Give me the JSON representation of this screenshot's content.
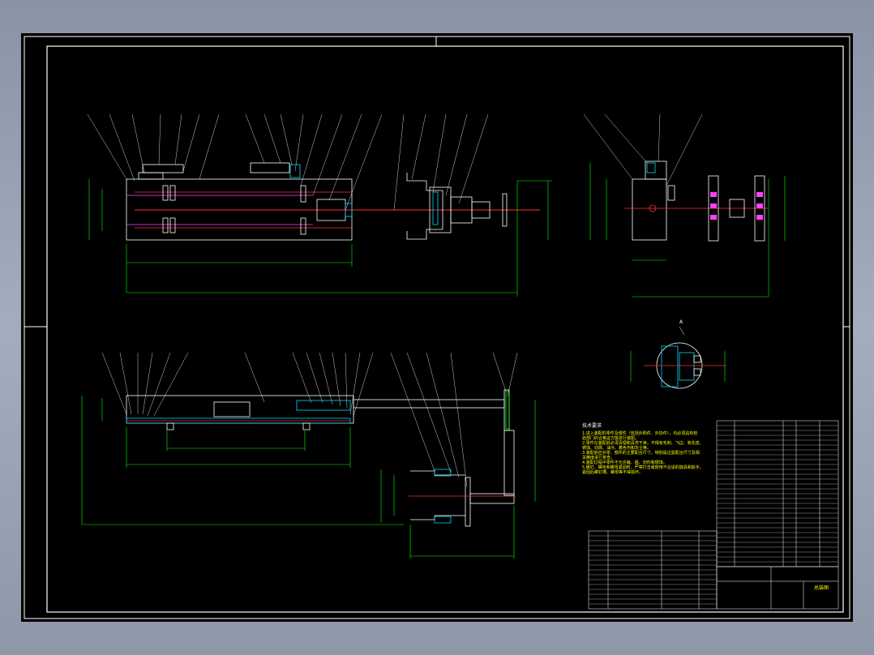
{
  "drawing": {
    "colors": {
      "background": "#000000",
      "frame": "#ffffff",
      "dimension": "#00ff00",
      "leader": "#ffffff",
      "center_line": "#ff3030",
      "part_cyan": "#00d8ff",
      "part_magenta": "#ff40ff",
      "part_yellow": "#ffff00"
    },
    "section_label": "A",
    "technical_notes": {
      "title": "技术要求",
      "lines": [
        "1.进入装配的零件及部件（包括外购件、外协件），均必须具有检",
        "验部门的合格证方能进行装配。",
        "2.零件在装配前必须清理和清洗干净，不得有毛刺、飞边、氧化皮、",
        "锈蚀、切屑、油污、着色剂和灰尘等。",
        "3.装配前应对零、部件的主要配合尺寸，特别是过盈配合尺寸及相",
        "关精度进行复查。",
        "4.装配过程中零件不允许磕、碰、划伤和锈蚀。",
        "5.螺钉、螺栓和螺母紧固时，严禁打击或使用不合适的旋具和扳手，",
        "紧固后螺钉槽、螺母等不得损坏。"
      ]
    },
    "title_block": {
      "drawing_name": "总装图"
    }
  }
}
